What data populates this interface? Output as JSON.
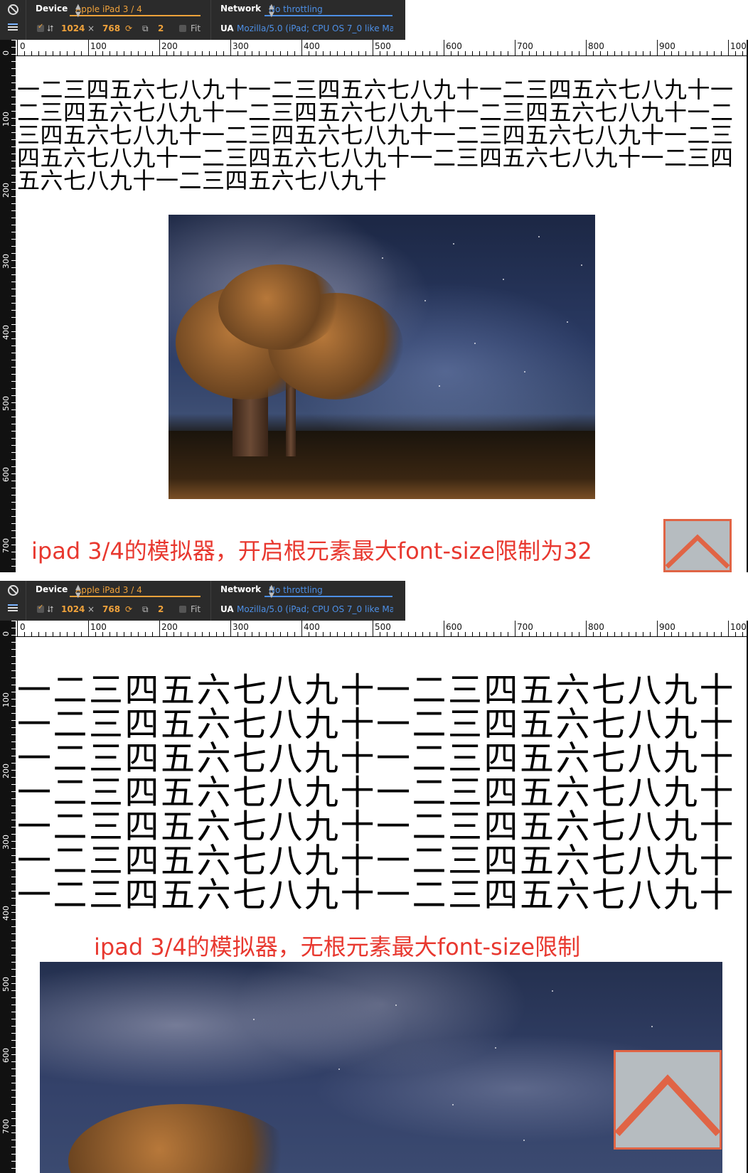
{
  "toolbar": {
    "device_label": "Device",
    "device_value": "Apple iPad 3 / 4",
    "network_label": "Network",
    "network_value": "No throttling",
    "width": "1024",
    "times": "×",
    "height": "768",
    "dpr": "2",
    "fit_label": "Fit",
    "ua_label": "UA",
    "ua_value": "Mozilla/5.0 (iPad; CPU OS 7_0 like Ma"
  },
  "ruler": {
    "top_labels": [
      "0",
      "100",
      "200",
      "300",
      "400",
      "500",
      "600",
      "700",
      "800",
      "900",
      "100"
    ],
    "left_labels": [
      "0",
      "100",
      "200",
      "300",
      "400",
      "500",
      "600",
      "700"
    ]
  },
  "panel1": {
    "text": "一二三四五六七八九十一二三四五六七八九十一二三四五六七八九十一二三四五六七八九十一二三四五六七八九十一二三四五六七八九十一二三四五六七八九十一二三四五六七八九十一二三四五六七八九十一二三四五六七八九十一二三四五六七八九十一二三四五六七八九十一二三四五六七八九十一二三四五六七八九十",
    "caption": "ipad 3/4的模拟器，开启根元素最大font-size限制为32"
  },
  "panel2": {
    "text": "一二三四五六七八九十一二三四五六七八九十\n一二三四五六七八九十一二三四五六七八九十\n一二三四五六七八九十一二三四五六七八九十\n一二三四五六七八九十一二三四五六七八九十\n一二三四五六七八九十一二三四五六七八九十\n一二三四五六七八九十一二三四五六七八九十\n一二三四五六七八九十一二三四五六七八九十",
    "caption": "ipad 3/4的模拟器，无根元素最大font-size限制"
  },
  "colors": {
    "caption": "#e8382f",
    "button_border": "#e06445",
    "button_fill": "#b6bcc0",
    "device_accent": "#f0a23b",
    "network_accent": "#4d8fe5"
  },
  "icons": [
    "no-entry-icon",
    "menu-icon",
    "rotate-icon",
    "screen-icon",
    "chevron-up-icon"
  ]
}
